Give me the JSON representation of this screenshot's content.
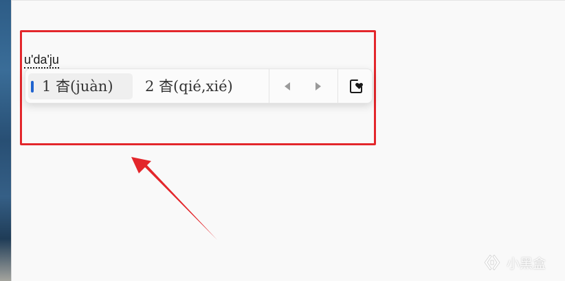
{
  "ime": {
    "composition": "u'da'ju",
    "candidates": [
      {
        "index": "1",
        "text": "杳(juàn)",
        "selected": true
      },
      {
        "index": "2",
        "text": "杳(qié,xié)",
        "selected": false
      }
    ],
    "prev_icon": "triangle-left-icon",
    "next_icon": "triangle-right-icon",
    "favorite_icon": "heart-bookmark-icon"
  },
  "annotation": {
    "box_color": "#e3262b",
    "arrow_color": "#e3262b"
  },
  "watermark": {
    "logo_icon": "xiaoheihe-logo",
    "text": "小黑盒"
  },
  "colors": {
    "selection_accent": "#1f63cf",
    "background": "#f9f9f9"
  }
}
